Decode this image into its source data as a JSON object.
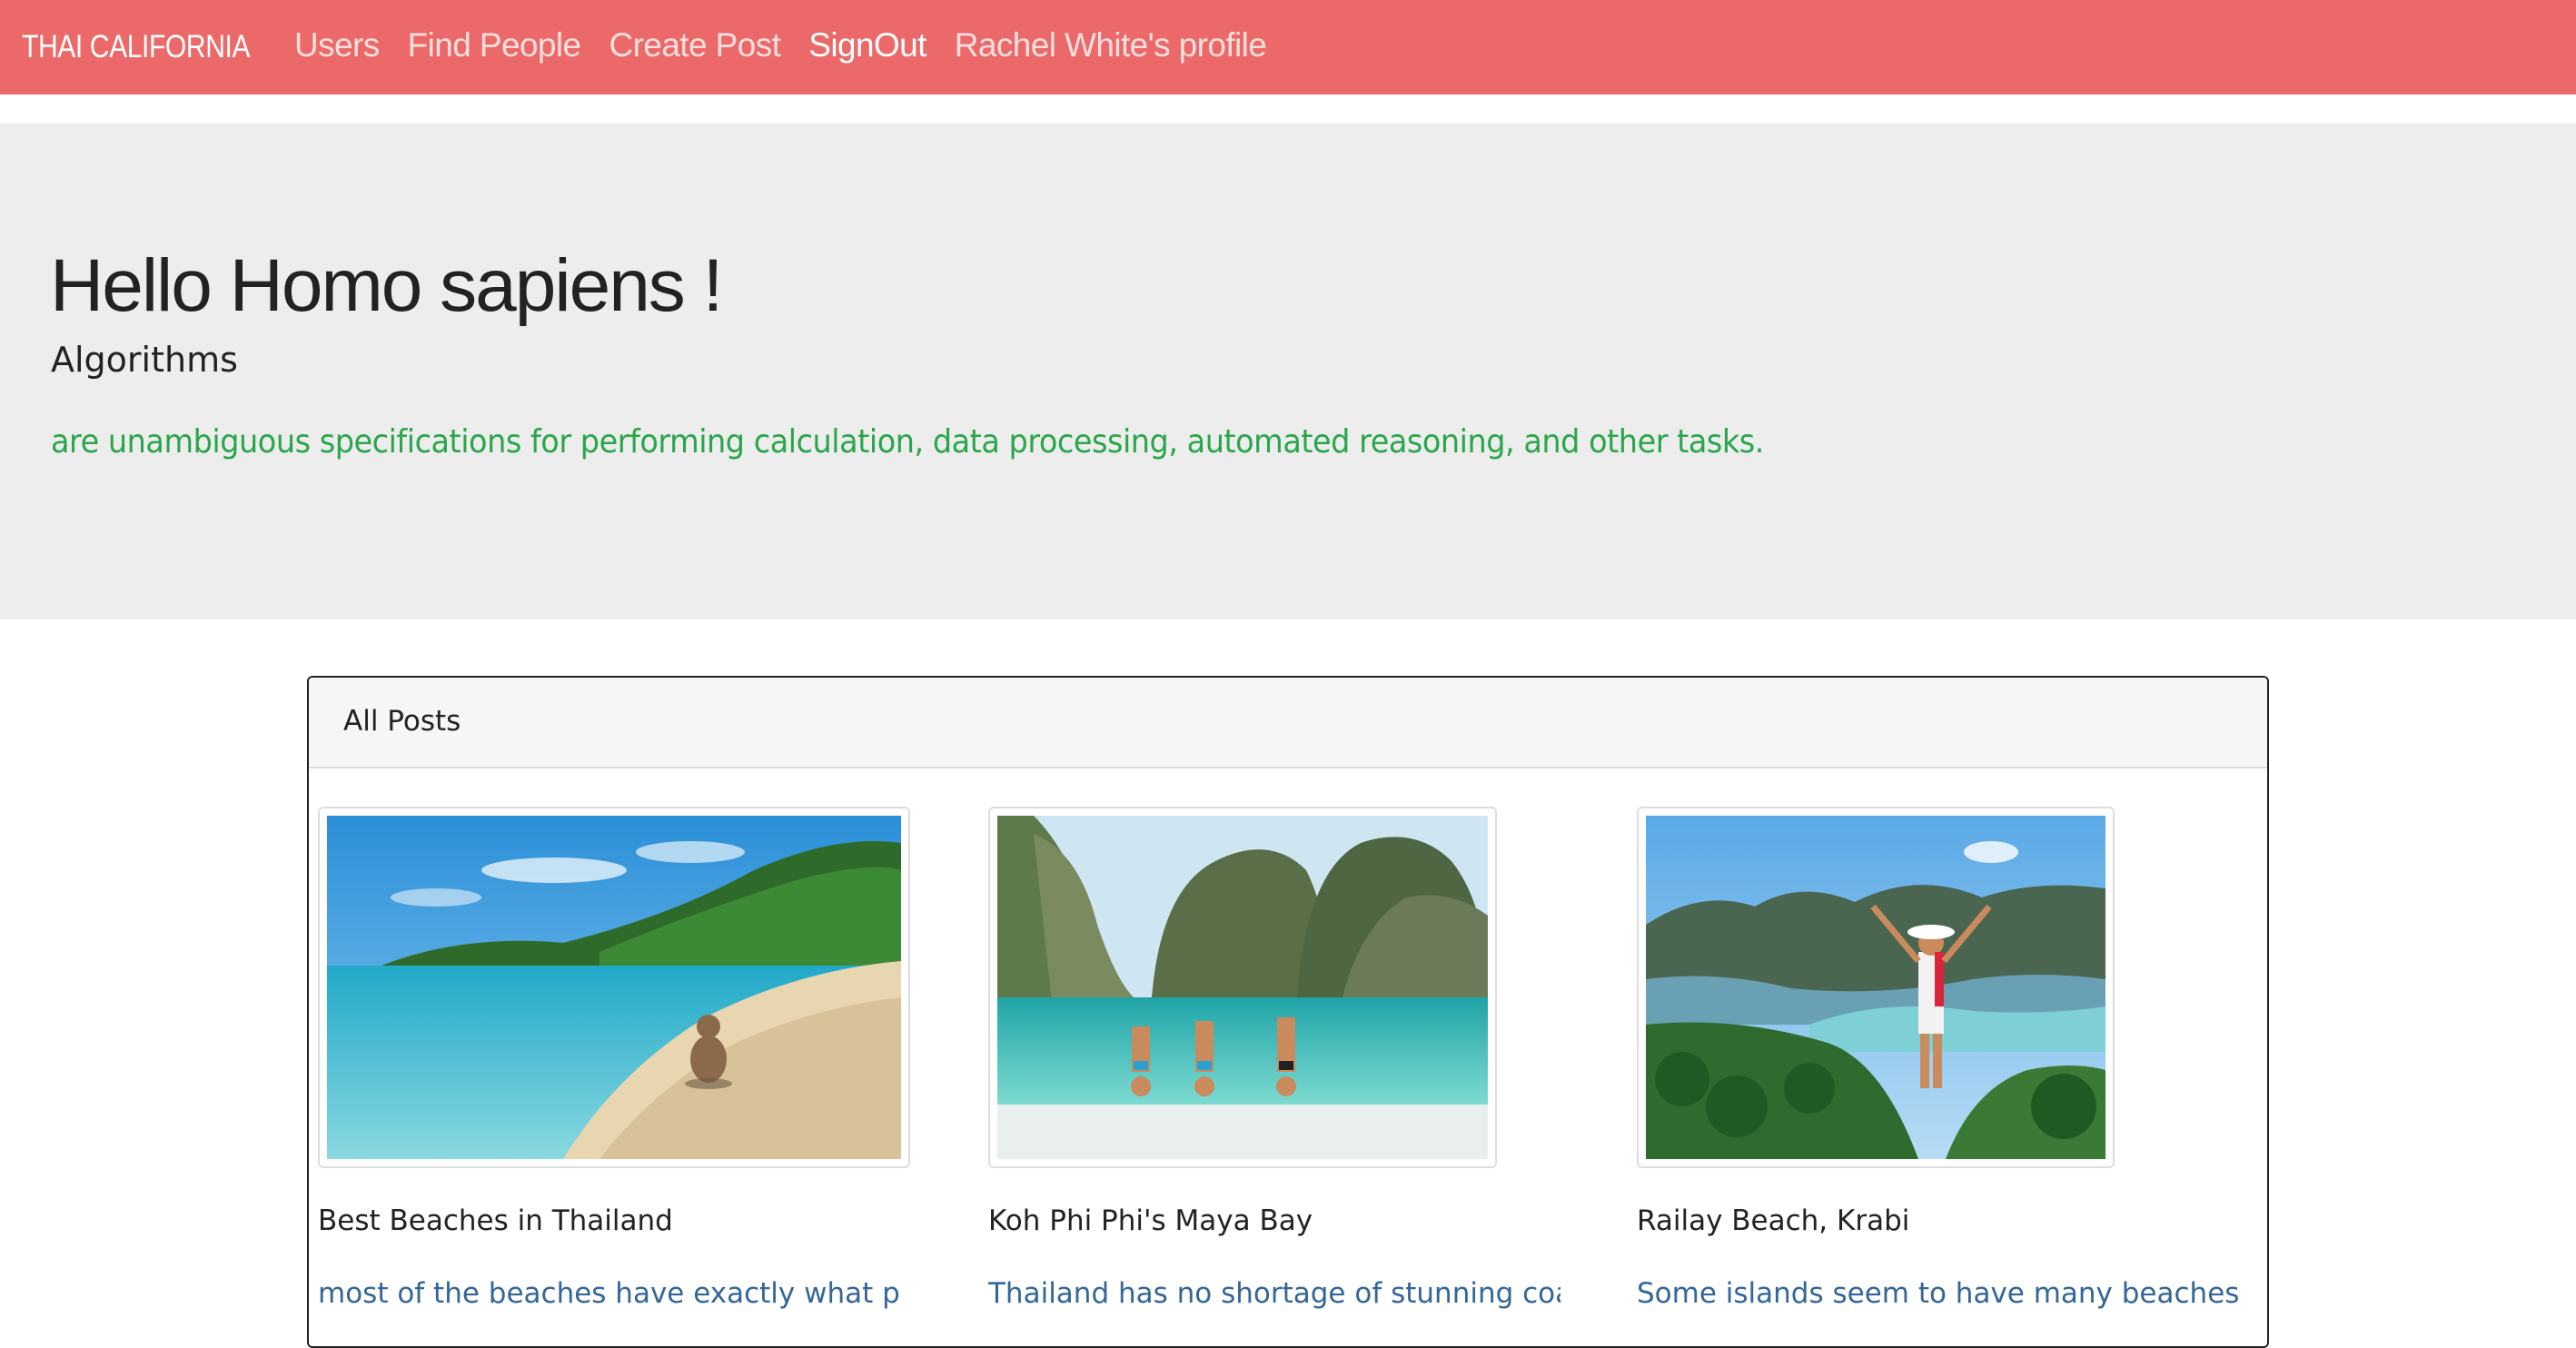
{
  "navbar": {
    "brand": "THAI CALIFORNIA",
    "links": [
      {
        "label": "Users"
      },
      {
        "label": "Find People"
      },
      {
        "label": "Create Post"
      },
      {
        "label": "SignOut"
      },
      {
        "label": "Rachel White's profile"
      }
    ],
    "background_color": "#eb6a69"
  },
  "jumbotron": {
    "heading": "Hello Homo sapiens !",
    "subtitle": "Algorithms",
    "lead": "are unambiguous specifications for performing calculation, data processing, automated reasoning, and other tasks.",
    "lead_color": "#2aa64a"
  },
  "posts_panel": {
    "title": "All Posts",
    "posts": [
      {
        "image_icon": "beach-monkey-photo",
        "title": "Best Beaches in Thailand",
        "excerpt": "most of the beaches have exactly what people are l"
      },
      {
        "image_icon": "maya-bay-handstand-photo",
        "title": "Koh Phi Phi's Maya Bay",
        "excerpt": "Thailand has no shortage of stunning coastline, wi"
      },
      {
        "image_icon": "railay-viewpoint-photo",
        "title": "Railay Beach, Krabi",
        "excerpt": "Some islands seem to have many beaches that have m"
      }
    ]
  }
}
